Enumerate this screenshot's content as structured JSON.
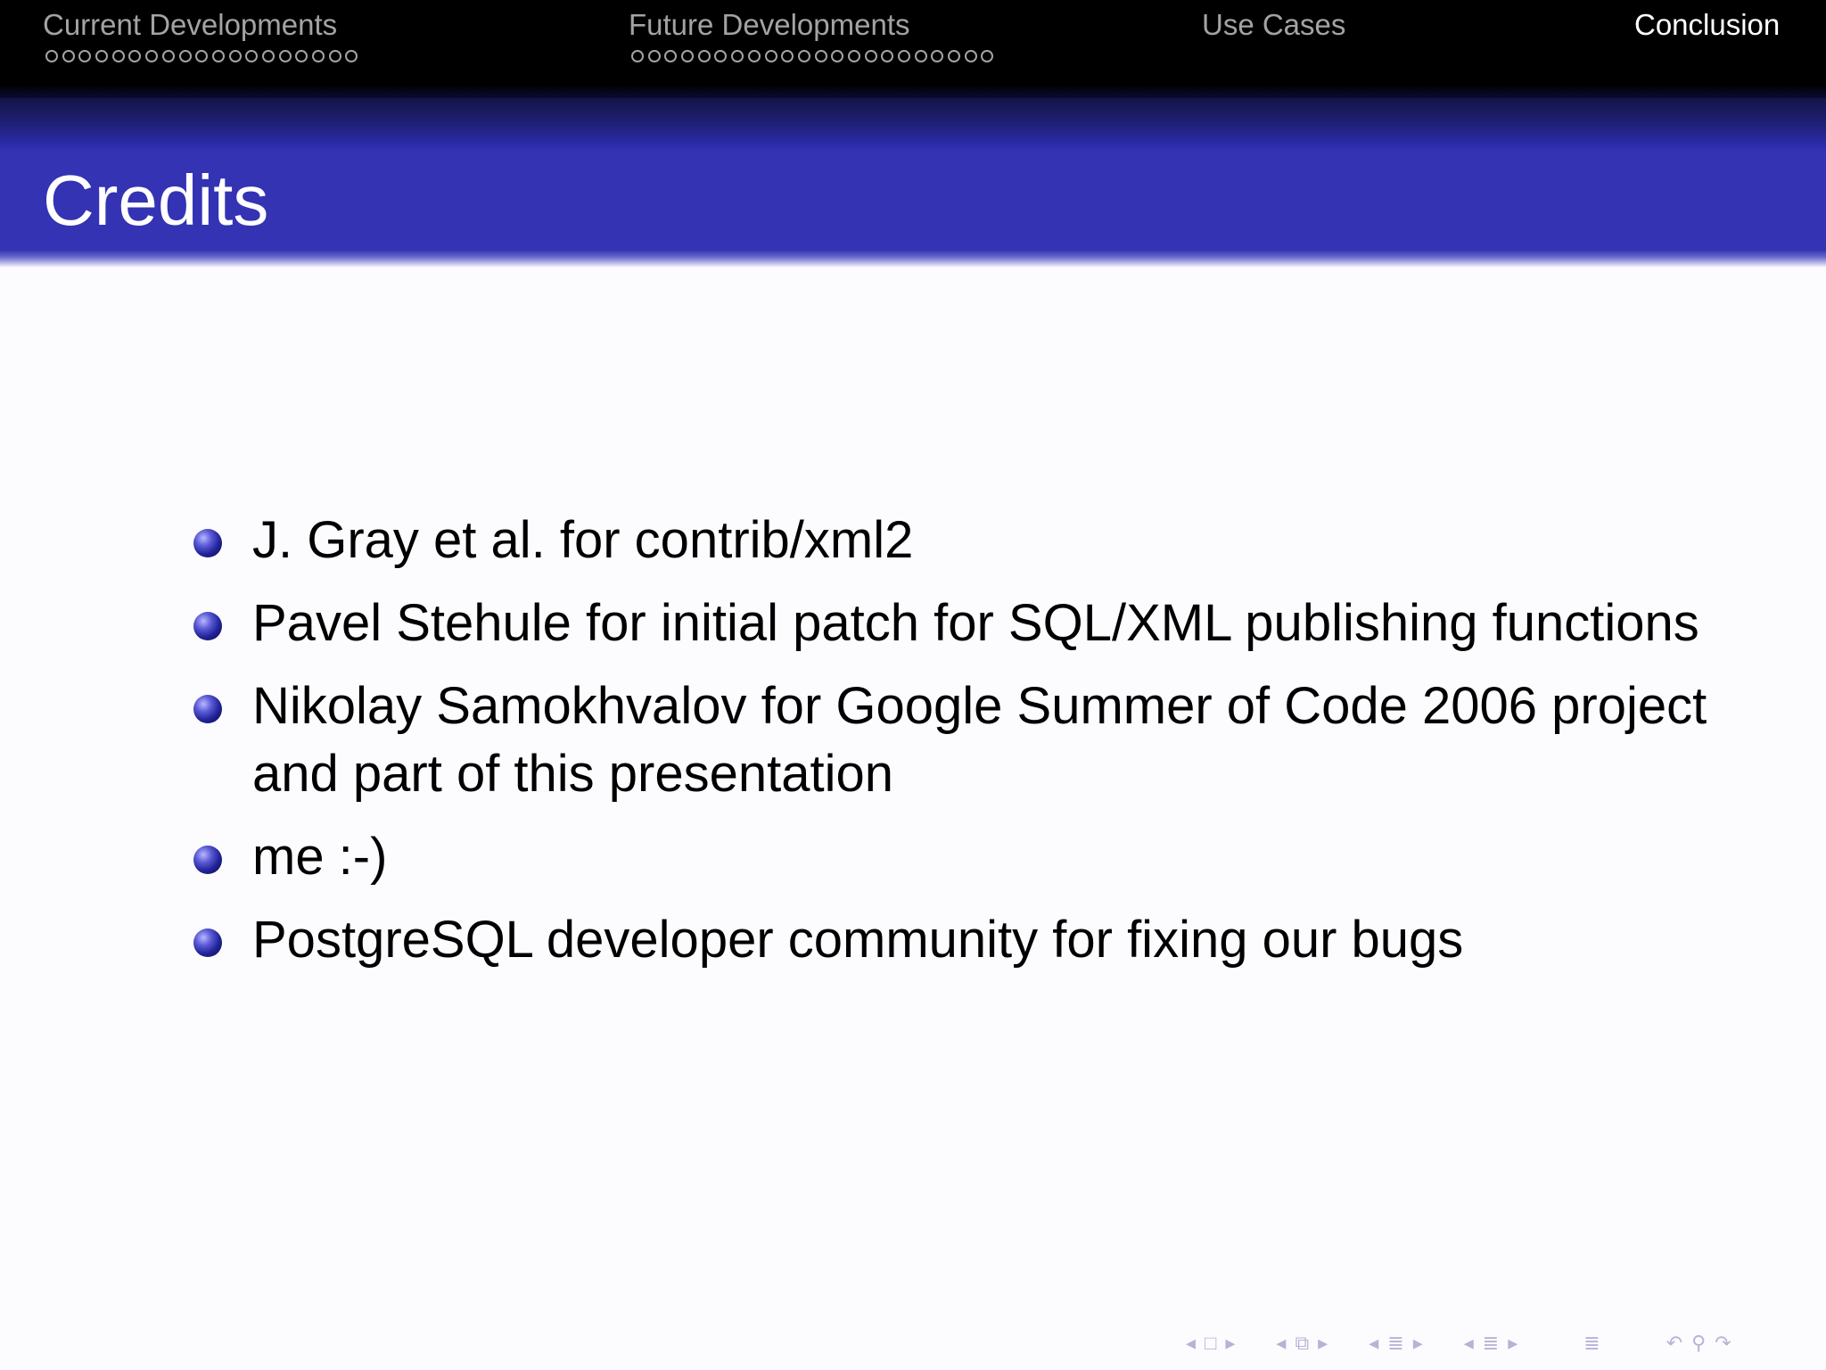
{
  "header": {
    "sections": [
      {
        "label": "Current Developments",
        "dots": 19,
        "active": false
      },
      {
        "label": "Future Developments",
        "dots": 22,
        "active": false
      },
      {
        "label": "Use Cases",
        "dots": 0,
        "active": false
      },
      {
        "label": "Conclusion",
        "dots": 0,
        "active": true
      }
    ]
  },
  "frame": {
    "title": "Credits"
  },
  "items": [
    "J. Gray et al. for contrib/xml2",
    "Pavel Stehule for initial patch for SQL/XML publishing functions",
    "Nikolay Samokhvalov for Google Summer of Code 2006 project and part of this presentation",
    "me :-)",
    "PostgreSQL developer community for fixing our bugs"
  ],
  "colors": {
    "header_bg": "#000000",
    "title_band": "#3333b3",
    "active_section": "#ffffff",
    "inactive_section": "#a3a3a3"
  },
  "nav_icons": [
    "arrow-left-icon",
    "frame-icon",
    "arrow-right-icon",
    "arrow-left-icon",
    "subsection-icon",
    "arrow-right-icon",
    "arrow-left-icon",
    "section-icon",
    "arrow-right-icon",
    "arrow-left-icon",
    "section-icon",
    "arrow-right-icon",
    "align-icon",
    "back-icon",
    "search-icon",
    "forward-icon"
  ]
}
